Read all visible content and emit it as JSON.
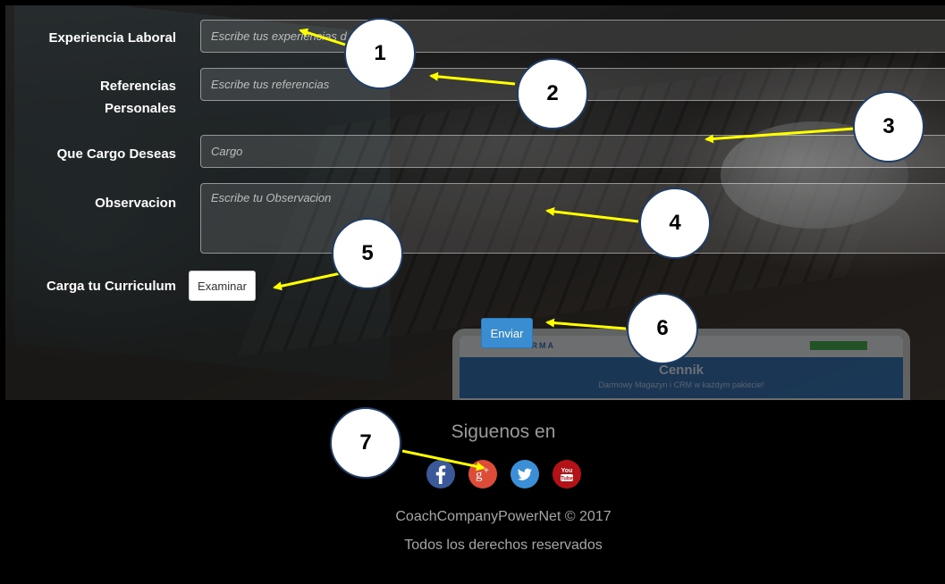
{
  "form": {
    "experiencia": {
      "label": "Experiencia Laboral",
      "placeholder": "Escribe tus experiencias d"
    },
    "referencias": {
      "label_line1": "Referencias",
      "label_line2": "Personales",
      "placeholder": "Escribe tus referencias"
    },
    "cargo": {
      "label": "Que Cargo Deseas",
      "placeholder": "Cargo"
    },
    "observacion": {
      "label": "Observacion",
      "placeholder": "Escribe tu Observacion"
    },
    "curriculum": {
      "label": "Carga tu Curriculum",
      "button_label": "Examinar"
    },
    "submit_label": "Enviar"
  },
  "background_tablet": {
    "brand": "IFIRMA",
    "title": "Cennik",
    "subtitle": "Darmowy Magazyn i CRM w każdym pakiecie!"
  },
  "footer": {
    "follow_label": "Siguenos en",
    "social": [
      {
        "name": "facebook",
        "glyph": "f",
        "color": "#3b5998"
      },
      {
        "name": "google-plus",
        "glyph": "g+",
        "color": "#dd4b39"
      },
      {
        "name": "twitter",
        "glyph": "twitter-bird",
        "color": "#3b8fd6"
      },
      {
        "name": "youtube",
        "glyph": "You Tube",
        "color": "#b31217"
      }
    ],
    "copyright": "CoachCompanyPowerNet © 2017",
    "rights": "Todos los derechos reservados"
  },
  "callouts": [
    "1",
    "2",
    "3",
    "4",
    "5",
    "6",
    "7"
  ],
  "colors": {
    "arrow": "#ffff00",
    "callout_border": "#1f3d66",
    "submit": "#3a8dd0"
  }
}
